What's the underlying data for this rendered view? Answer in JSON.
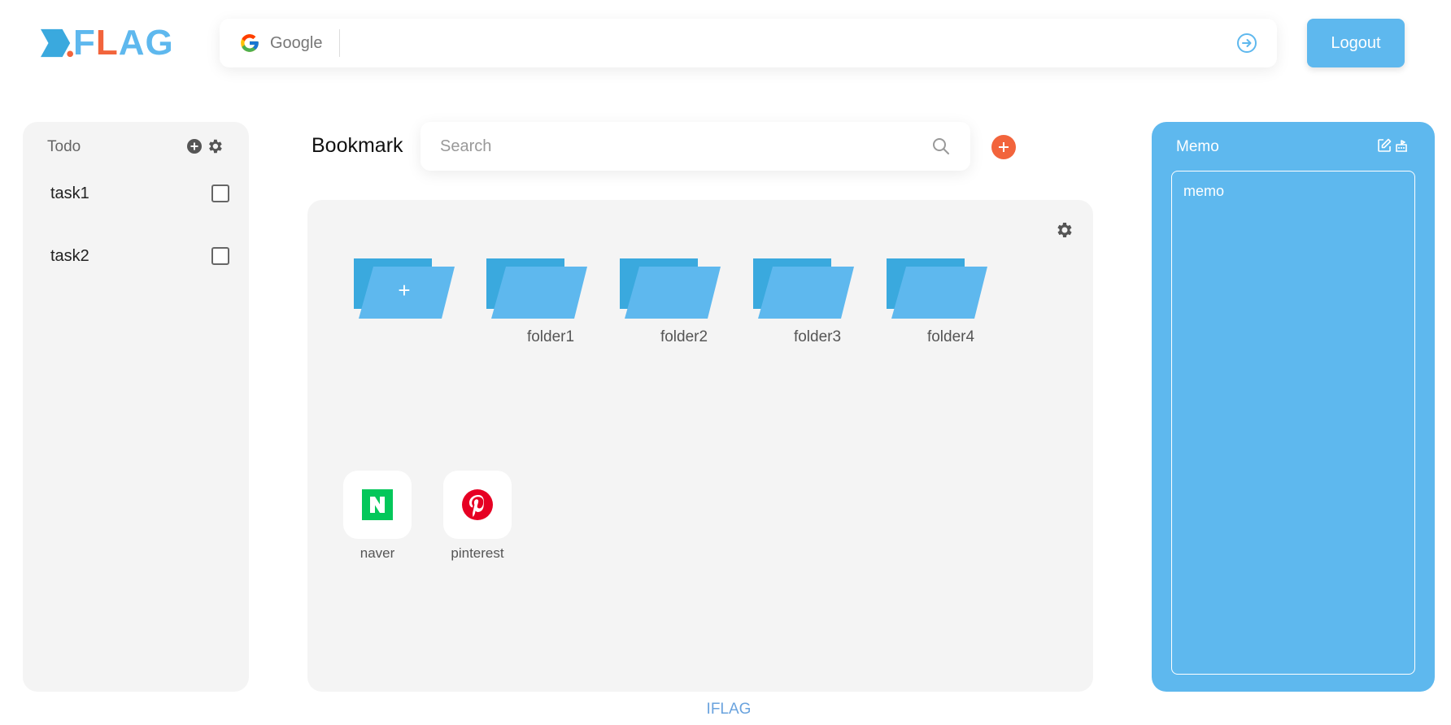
{
  "header": {
    "logo_text_a": "F",
    "logo_text_l": "L",
    "logo_text_b": "AG",
    "google_label": "Google",
    "google_input_value": "",
    "logout_label": "Logout"
  },
  "todo": {
    "title": "Todo",
    "tasks": [
      {
        "label": "task1",
        "checked": false
      },
      {
        "label": "task2",
        "checked": false
      }
    ]
  },
  "bookmark": {
    "title": "Bookmark",
    "search_placeholder": "Search",
    "add_folder_symbol": "+",
    "folders": [
      "folder1",
      "folder2",
      "folder3",
      "folder4"
    ],
    "sites": [
      {
        "label": "naver",
        "icon": "naver-icon"
      },
      {
        "label": "pinterest",
        "icon": "pinterest-icon"
      }
    ]
  },
  "memo": {
    "title": "Memo",
    "content": "memo"
  },
  "footer": {
    "text": "IFLAG"
  },
  "colors": {
    "accent_blue": "#5eb8ee",
    "folder_dark": "#3aa9de",
    "accent_orange": "#f2643c",
    "panel_gray": "#f4f4f4",
    "naver_green": "#03c75a",
    "pinterest_red": "#e60023"
  }
}
